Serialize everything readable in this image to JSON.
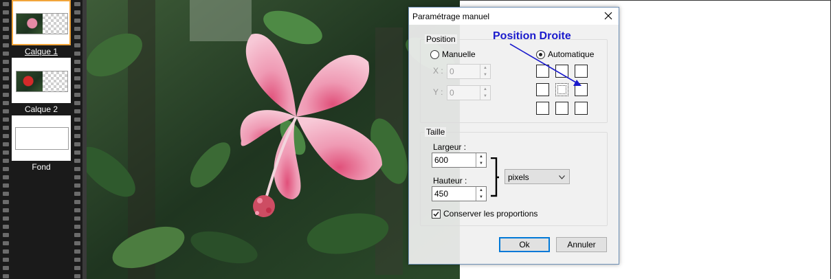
{
  "layers": [
    {
      "name": "Calque 1",
      "selected": true,
      "thumbnail": "flower-pink-half"
    },
    {
      "name": "Calque 2",
      "selected": false,
      "thumbnail": "flower-red-half"
    },
    {
      "name": "Fond",
      "selected": false,
      "thumbnail": "blank-white"
    }
  ],
  "dialog": {
    "title": "Paramétrage manuel",
    "close_icon": "close-icon",
    "position": {
      "group_title": "Position",
      "manual_label": "Manuelle",
      "auto_label": "Automatique",
      "selected_mode": "Automatique",
      "x_label": "X :",
      "x_value": "0",
      "y_label": "Y :",
      "y_value": "0",
      "anchor_selected": "center"
    },
    "size": {
      "group_title": "Taille",
      "width_label": "Largeur :",
      "width_value": "600",
      "height_label": "Hauteur :",
      "height_value": "450",
      "unit": "pixels",
      "keep_ratio_label": "Conserver les proportions",
      "keep_ratio_checked": true
    },
    "ok_label": "Ok",
    "cancel_label": "Annuler"
  },
  "annotation": {
    "text": "Position Droite",
    "color": "#1a1acc"
  },
  "colors": {
    "selection": "#f2a53a",
    "default_button": "#0078d7"
  }
}
